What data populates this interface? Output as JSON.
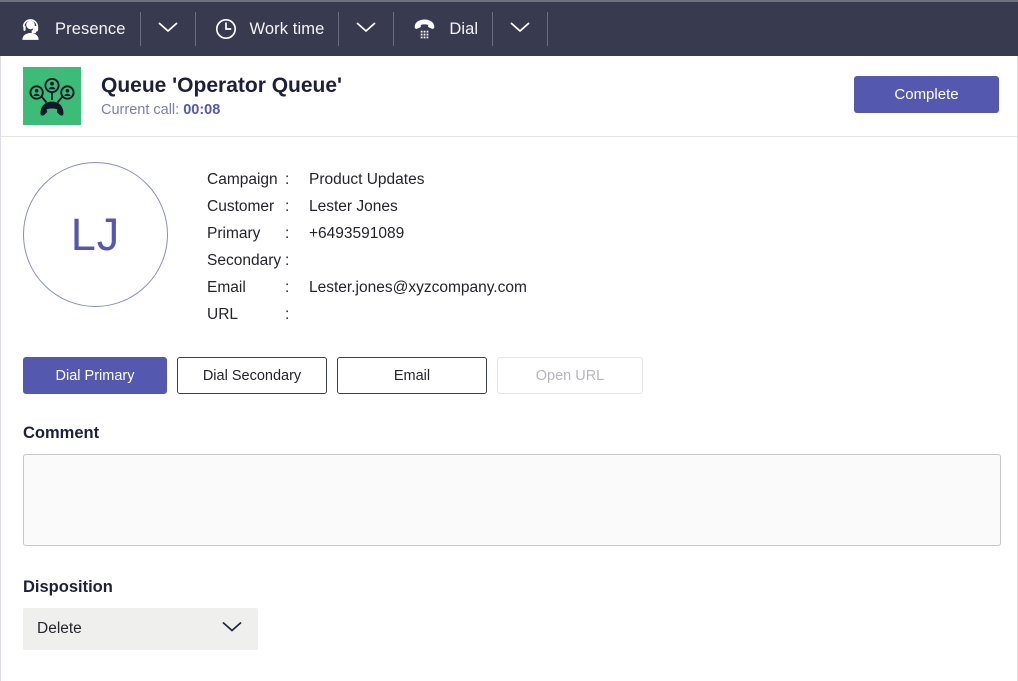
{
  "topbar": {
    "items": [
      {
        "icon": "agent-headset-icon",
        "label": "Presence",
        "caret": "chevron-down-icon"
      },
      {
        "icon": "clock-icon",
        "label": "Work time",
        "caret": "chevron-down-icon"
      },
      {
        "icon": "dial-pad-phone-icon",
        "label": "Dial",
        "caret": "chevron-down-icon"
      }
    ],
    "background_color": "#383a4f"
  },
  "queue_header": {
    "icon": "queue-group-call-icon",
    "icon_background": "#3cbc77",
    "title": "Queue 'Operator Queue'",
    "current_call_label": "Current call:",
    "current_call_time": "00:08",
    "complete_button": "Complete",
    "accent_color": "#5558af"
  },
  "contact": {
    "avatar_initials": "LJ",
    "fields": [
      {
        "key": "Campaign",
        "colon": ":",
        "value": "Product Updates"
      },
      {
        "key": "Customer",
        "colon": ":",
        "value": "Lester Jones"
      },
      {
        "key": "Primary",
        "colon": ":",
        "value": "+6493591089"
      },
      {
        "key": "Secondary",
        "colon": ":",
        "value": ""
      },
      {
        "key": "Email",
        "colon": ":",
        "value": "Lester.jones@xyzcompany.com"
      },
      {
        "key": "URL",
        "colon": ":",
        "value": ""
      }
    ]
  },
  "actions": {
    "dial_primary": "Dial Primary",
    "dial_secondary": "Dial Secondary",
    "email": "Email",
    "open_url": "Open URL"
  },
  "comment": {
    "label": "Comment",
    "value": "",
    "placeholder": ""
  },
  "disposition": {
    "label": "Disposition",
    "selected": "Delete",
    "caret": "chevron-down-icon"
  }
}
